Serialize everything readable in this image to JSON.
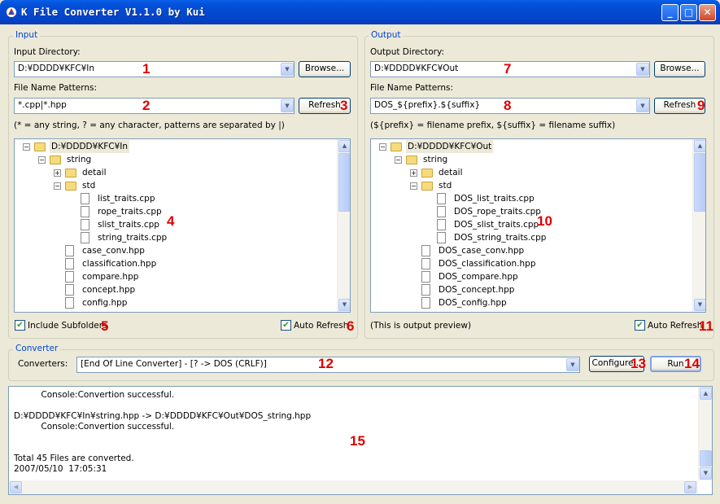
{
  "window": {
    "title": "K File Converter V1.1.0 by Kui",
    "minimize": "_",
    "maximize": "□",
    "close": "✕"
  },
  "input": {
    "group_label": "Input",
    "dir_label": "Input Directory:",
    "dir_value": "D:¥DDDD¥KFC¥In",
    "browse_label": "Browse...",
    "pattern_label": "File Name Patterns:",
    "pattern_value": "*.cpp|*.hpp",
    "refresh_label": "Refresh",
    "hint": "(* = any string, ? = any character, patterns are separated by |)",
    "tree": [
      {
        "label": "D:¥DDDD¥KFC¥In",
        "level": 0,
        "kind": "folder",
        "toggle": "−",
        "selected": true
      },
      {
        "label": "string",
        "level": 1,
        "kind": "folder",
        "toggle": "−"
      },
      {
        "label": "detail",
        "level": 2,
        "kind": "folder",
        "toggle": "+"
      },
      {
        "label": "std",
        "level": 2,
        "kind": "folder",
        "toggle": "−"
      },
      {
        "label": "list_traits.cpp",
        "level": 3,
        "kind": "file"
      },
      {
        "label": "rope_traits.cpp",
        "level": 3,
        "kind": "file"
      },
      {
        "label": "slist_traits.cpp",
        "level": 3,
        "kind": "file"
      },
      {
        "label": "string_traits.cpp",
        "level": 3,
        "kind": "file"
      },
      {
        "label": "case_conv.hpp",
        "level": 2,
        "kind": "file"
      },
      {
        "label": "classification.hpp",
        "level": 2,
        "kind": "file"
      },
      {
        "label": "compare.hpp",
        "level": 2,
        "kind": "file"
      },
      {
        "label": "concept.hpp",
        "level": 2,
        "kind": "file"
      },
      {
        "label": "config.hpp",
        "level": 2,
        "kind": "file"
      }
    ],
    "include_subfolders_label": "Include Subfolders",
    "include_subfolders_checked": true,
    "auto_refresh_label": "Auto Refresh",
    "auto_refresh_checked": true
  },
  "output": {
    "group_label": "Output",
    "dir_label": "Output Directory:",
    "dir_value": "D:¥DDDD¥KFC¥Out",
    "browse_label": "Browse...",
    "pattern_label": "File Name Patterns:",
    "pattern_value": "DOS_${prefix}.${suffix}",
    "refresh_label": "Refresh",
    "hint": "(${prefix} = filename prefix, ${suffix} = filename suffix)",
    "tree": [
      {
        "label": "D:¥DDDD¥KFC¥Out",
        "level": 0,
        "kind": "folder",
        "toggle": "−",
        "selected": true
      },
      {
        "label": "string",
        "level": 1,
        "kind": "folder",
        "toggle": "−"
      },
      {
        "label": "detail",
        "level": 2,
        "kind": "folder",
        "toggle": "+"
      },
      {
        "label": "std",
        "level": 2,
        "kind": "folder",
        "toggle": "−"
      },
      {
        "label": "DOS_list_traits.cpp",
        "level": 3,
        "kind": "file"
      },
      {
        "label": "DOS_rope_traits.cpp",
        "level": 3,
        "kind": "file"
      },
      {
        "label": "DOS_slist_traits.cpp",
        "level": 3,
        "kind": "file"
      },
      {
        "label": "DOS_string_traits.cpp",
        "level": 3,
        "kind": "file"
      },
      {
        "label": "DOS_case_conv.hpp",
        "level": 2,
        "kind": "file"
      },
      {
        "label": "DOS_classification.hpp",
        "level": 2,
        "kind": "file"
      },
      {
        "label": "DOS_compare.hpp",
        "level": 2,
        "kind": "file"
      },
      {
        "label": "DOS_concept.hpp",
        "level": 2,
        "kind": "file"
      },
      {
        "label": "DOS_config.hpp",
        "level": 2,
        "kind": "file"
      }
    ],
    "preview_note": "(This is output preview)",
    "auto_refresh_label": "Auto Refresh",
    "auto_refresh_checked": true
  },
  "converter": {
    "group_label": "Converter",
    "converters_label": "Converters:",
    "converter_value": "[End Of Line Converter] - [? -> DOS (CRLF)]",
    "configure_label": "Configure...",
    "run_label": "Run"
  },
  "log": {
    "lines": [
      "          Console:Convertion successful.",
      "",
      "D:¥DDDD¥KFC¥In¥string.hpp -> D:¥DDDD¥KFC¥Out¥DOS_string.hpp",
      "          Console:Convertion successful.",
      "",
      "",
      "Total 45 Files are converted.",
      "2007/05/10  17:05:31"
    ]
  },
  "annotations": [
    "1",
    "2",
    "3",
    "4",
    "5",
    "6",
    "7",
    "8",
    "9",
    "10",
    "11",
    "12",
    "13",
    "14",
    "15"
  ],
  "icons": {
    "check": "✔",
    "arrow_down": "▼",
    "arrow_up": "▲",
    "arrow_left": "◀",
    "arrow_right": "▶"
  },
  "colors": {
    "titlebar": "#0450D8",
    "group_label": "#0046D5",
    "annotation": "#E00000",
    "dialog_bg": "#ECE9D8"
  }
}
